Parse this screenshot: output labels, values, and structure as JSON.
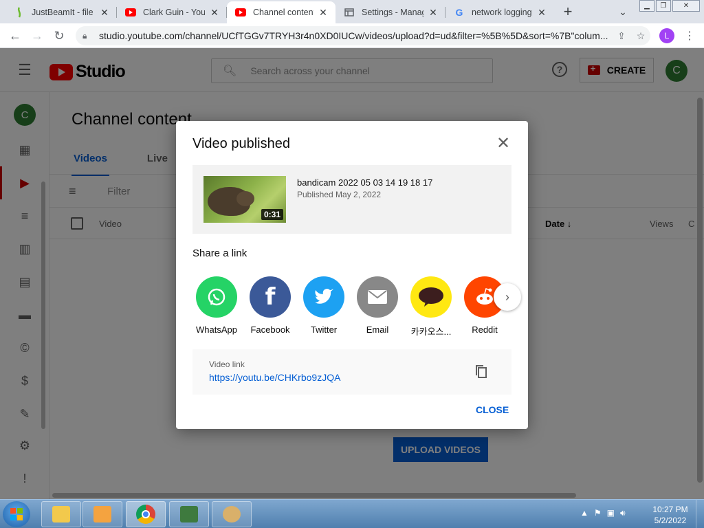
{
  "browser": {
    "tabs": [
      {
        "title": "JustBeamIt - file tr",
        "favicon": "justbeamit-icon"
      },
      {
        "title": "Clark Guin - YouTu",
        "favicon": "youtube-icon"
      },
      {
        "title": "Channel content -",
        "favicon": "youtube-icon",
        "active": true
      },
      {
        "title": "Settings - Manage",
        "favicon": "settings-icon"
      },
      {
        "title": "network logging -",
        "favicon": "google-icon"
      }
    ],
    "url": "studio.youtube.com/channel/UCfTGGv7TRYH3r4n0XD0IUCw/videos/upload?d=ud&filter=%5B%5D&sort=%7B\"colum...",
    "profile_initial": "L"
  },
  "studio": {
    "logo_text": "Studio",
    "search_placeholder": "Search across your channel",
    "create_label": "CREATE",
    "avatar_initial": "C",
    "page_title": "Channel content",
    "tabs": [
      "Videos",
      "Live"
    ],
    "filter_placeholder": "Filter",
    "columns": {
      "video": "Video",
      "date": "Date ↓",
      "views": "Views",
      "comments": "C"
    },
    "upload_button": "UPLOAD VIDEOS"
  },
  "dialog": {
    "title": "Video published",
    "video": {
      "title": "bandicam 2022 05 03 14 19 18 17",
      "published": "Published May 2, 2022",
      "duration": "0:31"
    },
    "share_title": "Share a link",
    "share_targets": [
      {
        "label": "WhatsApp",
        "color": "#25d366",
        "icon": "whatsapp-icon"
      },
      {
        "label": "Facebook",
        "color": "#3b5998",
        "icon": "facebook-icon"
      },
      {
        "label": "Twitter",
        "color": "#1da1f2",
        "icon": "twitter-icon"
      },
      {
        "label": "Email",
        "color": "#888888",
        "icon": "email-icon"
      },
      {
        "label": "카카오스...",
        "color": "#ffe812",
        "icon": "kakaotalk-icon"
      },
      {
        "label": "Reddit",
        "color": "#ff4500",
        "icon": "reddit-icon"
      }
    ],
    "link_label": "Video link",
    "link_url": "https://youtu.be/CHKrbo9zJQA",
    "close_label": "CLOSE"
  },
  "taskbar": {
    "time": "10:27 PM",
    "date": "5/2/2022"
  }
}
